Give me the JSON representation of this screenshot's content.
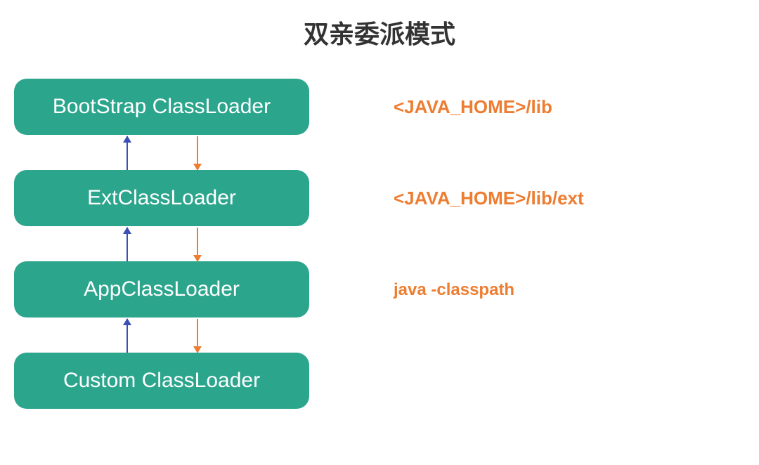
{
  "title": "双亲委派模式",
  "boxes": {
    "bootstrap": "BootStrap ClassLoader",
    "ext": "ExtClassLoader",
    "app": "AppClassLoader",
    "custom": "Custom ClassLoader"
  },
  "labels": {
    "bootstrap": "<JAVA_HOME>/lib",
    "ext": "<JAVA_HOME>/lib/ext",
    "app": "java -classpath"
  },
  "colors": {
    "box_bg": "#2ca58d",
    "box_text": "#ffffff",
    "label_color": "#ed7d31",
    "arrow_up": "#3b4fb5",
    "arrow_down": "#ed7d31"
  }
}
